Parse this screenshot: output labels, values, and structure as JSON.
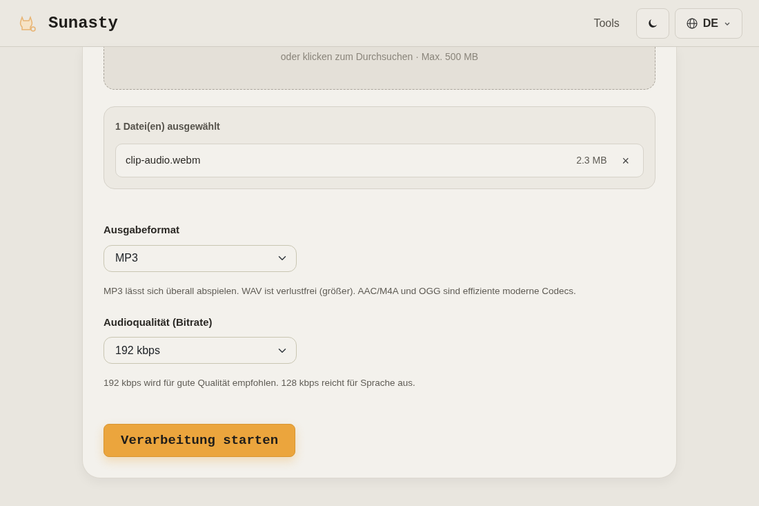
{
  "header": {
    "brand": "Sunasty",
    "nav_link": "Tools",
    "language": "DE"
  },
  "dropzone": {
    "hint": "oder klicken zum Durchsuchen · Max. 500 MB"
  },
  "selected_files": {
    "title": "1 Datei(en) ausgewählt",
    "files": [
      {
        "name": "clip-audio.webm",
        "size": "2.3 MB",
        "remove": "×"
      }
    ]
  },
  "fields": [
    {
      "label": "Ausgabeformat",
      "value": "MP3",
      "help": "MP3 lässt sich überall abspielen. WAV ist verlustfrei (größer). AAC/M4A und OGG sind effiziente moderne Codecs."
    },
    {
      "label": "Audioqualität (Bitrate)",
      "value": "192 kbps",
      "help": "192 kbps wird für gute Qualität empfohlen. 128 kbps reicht für Sprache aus."
    }
  ],
  "submit": "Verarbeitung starten"
}
